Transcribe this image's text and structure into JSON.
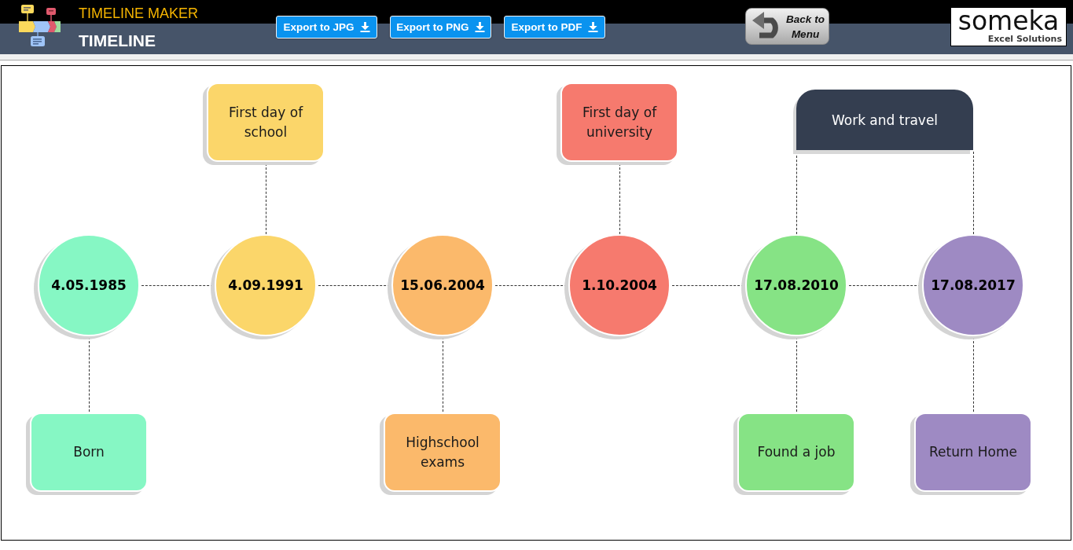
{
  "header": {
    "app_title": "TIMELINE MAKER",
    "page_title": "TIMELINE",
    "export_buttons": [
      {
        "label": "Export to JPG"
      },
      {
        "label": "Export to PNG"
      },
      {
        "label": "Export to PDF"
      }
    ],
    "back_button": {
      "label": "Back to Menu"
    },
    "brand": {
      "name": "someka",
      "tagline": "Excel Solutions"
    }
  },
  "timeline": {
    "items": [
      {
        "kind": "event",
        "date": "4.05.1985",
        "note_below": "Born",
        "color": "#86f7c4"
      },
      {
        "kind": "event",
        "date": "4.09.1991",
        "note_above": "First day of school",
        "color": "#fbd66a"
      },
      {
        "kind": "event",
        "date": "15.06.2004",
        "note_below": "Highschool exams",
        "color": "#fbb96b"
      },
      {
        "kind": "event",
        "date": "1.10.2004",
        "note_above": "First day of university",
        "color": "#f67a6e"
      },
      {
        "kind": "period",
        "label": "Work and travel",
        "color": "#343e50",
        "events": [
          {
            "kind": "event",
            "date": "17.08.2010",
            "note_below": "Found a job",
            "color": "#86e385"
          },
          {
            "kind": "event",
            "date": "17.08.2017",
            "note_below": "Return Home",
            "color": "#9e8ac3"
          }
        ]
      }
    ]
  }
}
